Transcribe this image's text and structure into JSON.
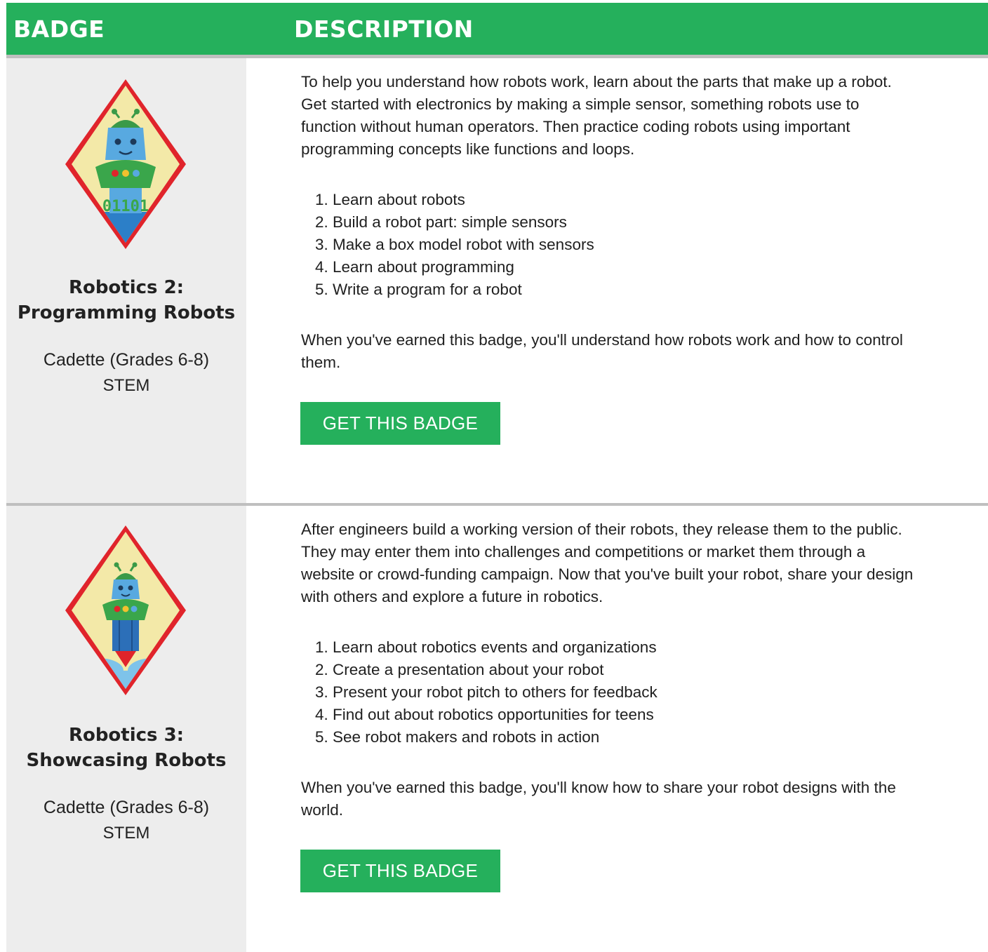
{
  "header": {
    "badge_label": "BADGE",
    "description_label": "DESCRIPTION"
  },
  "colors": {
    "accent_green": "#25b05c",
    "left_column_bg": "#ededed",
    "divider": "#bfbfbf"
  },
  "badges": [
    {
      "icon": "robot-badge-binary-icon",
      "name_line1": "Robotics 2:",
      "name_line2": "Programming Robots",
      "badge_text": "01101",
      "level": "Cadette (Grades 6-8)",
      "category": "STEM",
      "description_lines": [
        "To help you understand how robots work, learn about the parts that make up a robot.",
        "Get started with electronics by making a simple sensor, something robots use to",
        "function without human operators. Then practice coding robots using important",
        "programming concepts like functions and loops."
      ],
      "steps": [
        "1. Learn about robots",
        "2. Build a robot part: simple sensors",
        "3. Make a box model robot with sensors",
        "4. Learn about programming",
        "5. Write a program for a robot"
      ],
      "closing_lines": [
        "When you've earned this badge, you'll understand how robots work and how to control",
        "them."
      ],
      "button_label": "GET THIS BADGE"
    },
    {
      "icon": "robot-badge-rocket-icon",
      "name_line1": "Robotics 3:",
      "name_line2": "Showcasing Robots",
      "level": "Cadette (Grades 6-8)",
      "category": "STEM",
      "description_lines": [
        "After engineers build a working version of their robots, they release them to the public.",
        "They may enter them into challenges and competitions or market them through a",
        "website or crowd-funding campaign. Now that you've built your robot, share your design",
        "with others and explore a future in robotics."
      ],
      "steps": [
        "1. Learn about robotics events and organizations",
        "2. Create a presentation about your robot",
        "3. Present your robot pitch to others for feedback",
        "4. Find out about robotics opportunities for teens",
        "5. See robot makers and robots in action"
      ],
      "closing_lines": [
        "When you've earned this badge, you'll know how to share your robot designs with the",
        "world."
      ],
      "button_label": "GET THIS BADGE"
    }
  ]
}
